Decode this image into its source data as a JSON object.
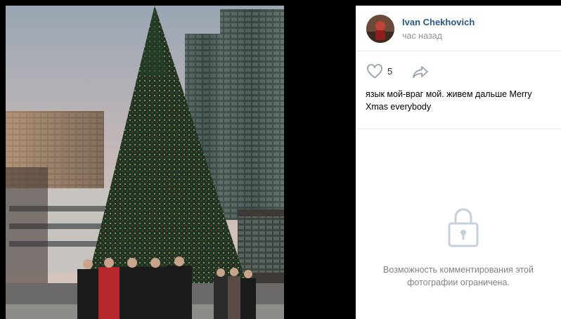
{
  "post": {
    "author_name": "Ivan Chekhovich",
    "time": "час назад",
    "likes": "5",
    "caption": "язык мой-враг мой. живем дальше Merry Xmas everybody"
  },
  "comments": {
    "closed_message": "Возможность комментирования этой фотографии ограничена."
  },
  "icons": {
    "like": "heart-outline-icon",
    "share": "share-arrow-icon",
    "comments_closed": "lock-icon"
  },
  "colors": {
    "author_link": "#2a5885",
    "secondary_text": "#939393",
    "icon_gray": "#99a2ad",
    "lock_gray": "#c5d0db"
  }
}
